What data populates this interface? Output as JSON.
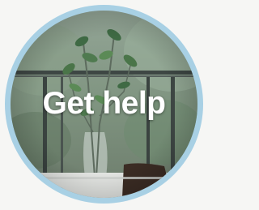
{
  "help_tile": {
    "label": "Get help",
    "ring_color": "#a8d0e4",
    "label_color": "#ffffff",
    "image_subject": "indoor-plant-by-window-photo"
  }
}
